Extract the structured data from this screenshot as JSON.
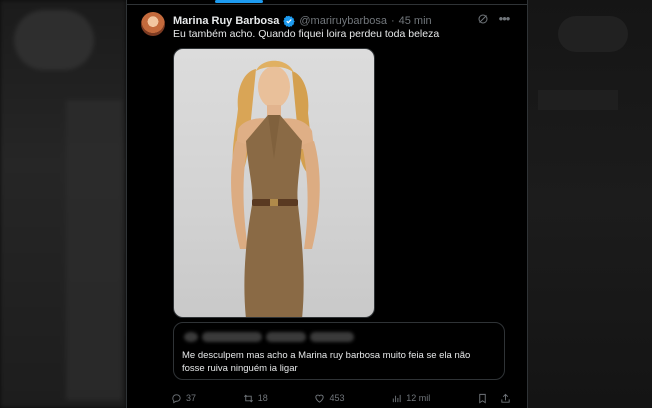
{
  "tweet": {
    "author_name": "Marina Ruy Barbosa",
    "handle": "@mariruybarbosa",
    "separator": "·",
    "time": "45 min",
    "text": "Eu também acho. Quando fiquei loira perdeu toda beleza"
  },
  "quote": {
    "text": "Me desculpem mas acho a Marina ruy barbosa muito feia se ela não fosse ruiva ninguém ia ligar"
  },
  "actions": {
    "replies": "37",
    "reposts": "18",
    "likes": "453",
    "views": "12 mil"
  },
  "icons": {
    "verified": "verified-badge-icon",
    "grok": "grok-icon",
    "more": "more-icon",
    "reply": "reply-icon",
    "repost": "repost-icon",
    "like": "heart-icon",
    "views": "views-icon",
    "bookmark": "bookmark-icon",
    "share": "share-icon"
  },
  "colors": {
    "accent": "#1d9bf0",
    "background": "#000000",
    "text": "#e7e9ea",
    "muted": "#71767b",
    "border": "#2f3336"
  }
}
